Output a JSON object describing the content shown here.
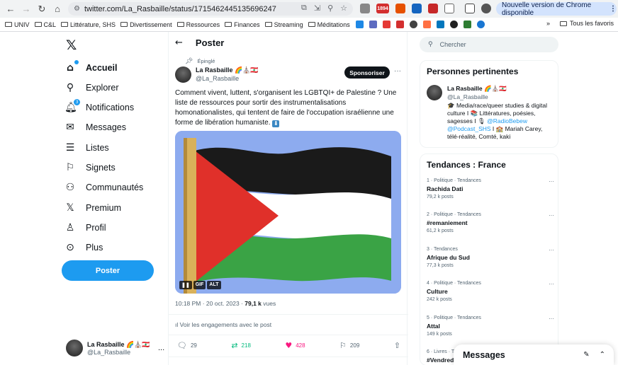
{
  "browser": {
    "url": "twitter.com/La_Rasbaille/status/1715462445135696247",
    "update_label": "Nouvelle version de Chrome disponible",
    "mail_badge": "1894",
    "bookmarks": [
      "UNIV",
      "C&L",
      "Littérature, SHS",
      "Divertissement",
      "Ressources",
      "Finances",
      "Streaming",
      "Méditations"
    ],
    "bookmarks_overflow": "»",
    "all_bookmarks": "Tous les favoris"
  },
  "nav": {
    "items": [
      {
        "label": "Accueil",
        "icon": "home-icon"
      },
      {
        "label": "Explorer",
        "icon": "search-icon"
      },
      {
        "label": "Notifications",
        "icon": "bell-icon",
        "badge": "3"
      },
      {
        "label": "Messages",
        "icon": "mail-icon"
      },
      {
        "label": "Listes",
        "icon": "list-icon"
      },
      {
        "label": "Signets",
        "icon": "bookmark-icon"
      },
      {
        "label": "Communautés",
        "icon": "communities-icon"
      },
      {
        "label": "Premium",
        "icon": "x-icon"
      },
      {
        "label": "Profil",
        "icon": "profile-icon"
      },
      {
        "label": "Plus",
        "icon": "more-icon"
      }
    ],
    "post_button": "Poster",
    "account": {
      "name": "La Rasbaille 🌈⛪🇱🇧",
      "handle": "@La_Rasbaille",
      "more": "..."
    }
  },
  "tweet": {
    "header_title": "Poster",
    "pinned": "Épinglé",
    "author_name": "La Rasbaille 🌈⛪🇱🇧",
    "author_handle": "@La_Rasbaille",
    "sponsor_label": "Sponsoriser",
    "text": "Comment vivent, luttent, s'organisent les LGBTQI+ de Palestine ? Une liste de ressources pour sortir des instrumentalisations homonationalistes, qui tentent de faire de l'occupation israélienne une forme de libération humaniste.",
    "text_emoji": "⬇",
    "media_badges": [
      "❚❚",
      "GIF",
      "ALT"
    ],
    "time": "10:18 PM · 20 oct. 2023 · ",
    "views": "79,1 k",
    "views_label": " vues",
    "engagements": "Voir les engagements avec le post",
    "replies": "29",
    "reposts": "218",
    "likes": "428",
    "bookmarks": "209",
    "colors": {
      "sky": "#8dabef",
      "black": "#1a1a1a",
      "white": "#ffffff",
      "green": "#3aa345",
      "red": "#e0302a"
    }
  },
  "right": {
    "search_placeholder": "Chercher",
    "people_title": "Personnes pertinentes",
    "person": {
      "name": "La Rasbaille 🌈⛪🇱🇧",
      "handle": "@La_Rasbaille",
      "bio_1": "🎓 Media/race/queer studies & digital culture I 📚 Littératures, poésies, sagesses I 🎙 ",
      "bio_link1": "@RadioBebew",
      "bio_link2": "@Podcast_SHS",
      "bio_2": " I 🏫 Mariah Carey, télé-réalité, Comté, kaki"
    },
    "trends_title": "Tendances : France",
    "trends": [
      {
        "category": "1 · Politique · Tendances",
        "name": "Rachida Dati",
        "count": "79,2 k posts"
      },
      {
        "category": "2 · Politique · Tendances",
        "name": "#remaniement",
        "count": "61,2 k posts"
      },
      {
        "category": "3 · Tendances",
        "name": "Afrique du Sud",
        "count": "77,3 k posts"
      },
      {
        "category": "4 · Politique · Tendances",
        "name": "Culture",
        "count": "242 k posts"
      },
      {
        "category": "5 · Politique · Tendances",
        "name": "Attal",
        "count": "149 k posts"
      },
      {
        "category": "6 · Livres · T",
        "name": "#Vendredi",
        "count": ""
      }
    ],
    "trend_more": "···"
  },
  "messages_drawer": {
    "title": "Messages"
  }
}
